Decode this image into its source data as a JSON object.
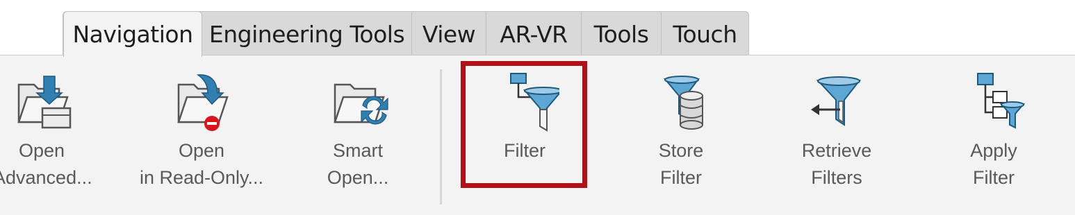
{
  "tabs": [
    {
      "label": "Navigation",
      "active": true
    },
    {
      "label": "Engineering Tools",
      "active": false
    },
    {
      "label": "View",
      "active": false
    },
    {
      "label": "AR-VR",
      "active": false
    },
    {
      "label": "Tools",
      "active": false
    },
    {
      "label": "Touch",
      "active": false
    }
  ],
  "commands": [
    {
      "line1": "Open",
      "line2": "Advanced...",
      "icon": "folder-open-advanced-icon"
    },
    {
      "line1": "Open",
      "line2": "in Read-Only...",
      "icon": "folder-open-readonly-icon"
    },
    {
      "line1": "Smart",
      "line2": "Open...",
      "icon": "folder-smart-open-icon"
    },
    {
      "line1": "Filter",
      "line2": "",
      "icon": "filter-icon"
    },
    {
      "line1": "Store",
      "line2": "Filter",
      "icon": "store-filter-icon"
    },
    {
      "line1": "Retrieve",
      "line2": "Filters",
      "icon": "retrieve-filters-icon"
    },
    {
      "line1": "Apply",
      "line2": "Filter",
      "icon": "apply-filter-icon"
    }
  ],
  "colors": {
    "highlight": "#b11116",
    "ribbon_bg": "#f3f3f3",
    "icon_blue": "#2f7fb0"
  }
}
